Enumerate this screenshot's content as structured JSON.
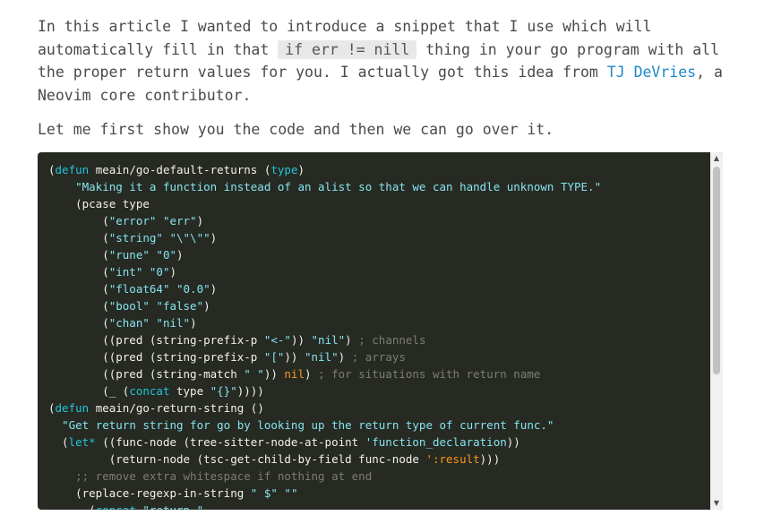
{
  "article": {
    "p1_before": "In this article I wanted to introduce a snippet that I use which will automatically fill in that ",
    "p1_code": "if err != nill",
    "p1_middle": " thing in your go program with all the proper return values for you. I actually got this idea from ",
    "p1_link": "TJ DeVries",
    "p1_after": ", a Neovim core contributor.",
    "p2": "Let me first show you the code and then we can go over it."
  },
  "code_block": {
    "lines": [
      [
        {
          "t": "("
        },
        {
          "t": "defun",
          "c": "kw"
        },
        {
          "t": " meain/go-default-returns ("
        },
        {
          "t": "type",
          "c": "kw"
        },
        {
          "t": ")"
        }
      ],
      [
        {
          "t": "    "
        },
        {
          "t": "\"Making it a function instead of an alist so that we can handle unknown TYPE.\"",
          "c": "str"
        }
      ],
      [
        {
          "t": "    (pcase type"
        }
      ],
      [
        {
          "t": "        ("
        },
        {
          "t": "\"error\"",
          "c": "str"
        },
        {
          "t": " "
        },
        {
          "t": "\"err\"",
          "c": "str"
        },
        {
          "t": ")"
        }
      ],
      [
        {
          "t": "        ("
        },
        {
          "t": "\"string\"",
          "c": "str"
        },
        {
          "t": " "
        },
        {
          "t": "\"\\\"\\\"\"",
          "c": "str"
        },
        {
          "t": ")"
        }
      ],
      [
        {
          "t": "        ("
        },
        {
          "t": "\"rune\"",
          "c": "str"
        },
        {
          "t": " "
        },
        {
          "t": "\"0\"",
          "c": "str"
        },
        {
          "t": ")"
        }
      ],
      [
        {
          "t": "        ("
        },
        {
          "t": "\"int\"",
          "c": "str"
        },
        {
          "t": " "
        },
        {
          "t": "\"0\"",
          "c": "str"
        },
        {
          "t": ")"
        }
      ],
      [
        {
          "t": "        ("
        },
        {
          "t": "\"float64\"",
          "c": "str"
        },
        {
          "t": " "
        },
        {
          "t": "\"0.0\"",
          "c": "str"
        },
        {
          "t": ")"
        }
      ],
      [
        {
          "t": "        ("
        },
        {
          "t": "\"bool\"",
          "c": "str"
        },
        {
          "t": " "
        },
        {
          "t": "\"false\"",
          "c": "str"
        },
        {
          "t": ")"
        }
      ],
      [
        {
          "t": "        ("
        },
        {
          "t": "\"chan\"",
          "c": "str"
        },
        {
          "t": " "
        },
        {
          "t": "\"nil\"",
          "c": "str"
        },
        {
          "t": ")"
        }
      ],
      [
        {
          "t": "        ((pred (string-prefix-p "
        },
        {
          "t": "\"<-\"",
          "c": "str"
        },
        {
          "t": ")) "
        },
        {
          "t": "\"nil\"",
          "c": "str"
        },
        {
          "t": ") "
        },
        {
          "t": "; channels",
          "c": "cm"
        }
      ],
      [
        {
          "t": "        ((pred (string-prefix-p "
        },
        {
          "t": "\"[\"",
          "c": "str"
        },
        {
          "t": ")) "
        },
        {
          "t": "\"nil\"",
          "c": "str"
        },
        {
          "t": ") "
        },
        {
          "t": "; arrays",
          "c": "cm"
        }
      ],
      [
        {
          "t": "        ((pred (string-match "
        },
        {
          "t": "\" \"",
          "c": "str"
        },
        {
          "t": ")) "
        },
        {
          "t": "nil",
          "c": "org"
        },
        {
          "t": ") "
        },
        {
          "t": "; for situations with return name",
          "c": "cm"
        }
      ],
      [
        {
          "t": "        (_ ("
        },
        {
          "t": "concat",
          "c": "kw"
        },
        {
          "t": " type "
        },
        {
          "t": "\"{}\"",
          "c": "str"
        },
        {
          "t": "))))"
        }
      ],
      [
        {
          "t": "("
        },
        {
          "t": "defun",
          "c": "kw"
        },
        {
          "t": " meain/go-return-string ()"
        }
      ],
      [
        {
          "t": "  "
        },
        {
          "t": "\"Get return string for go by looking up the return type of current func.\"",
          "c": "str"
        }
      ],
      [
        {
          "t": "  ("
        },
        {
          "t": "let*",
          "c": "kw"
        },
        {
          "t": " ((func-node (tree-sitter-node-at-point "
        },
        {
          "t": "'function_declaration",
          "c": "str"
        },
        {
          "t": "))"
        }
      ],
      [
        {
          "t": "         (return-node (tsc-get-child-by-field func-node "
        },
        {
          "t": "':result",
          "c": "org"
        },
        {
          "t": ")))"
        }
      ],
      [
        {
          "t": "    "
        },
        {
          "t": ";; remove extra whitespace if nothing at end",
          "c": "cm"
        }
      ],
      [
        {
          "t": "    (replace-regexp-in-string "
        },
        {
          "t": "\" $\"",
          "c": "str"
        },
        {
          "t": " "
        },
        {
          "t": "\"\"",
          "c": "str"
        }
      ],
      [
        {
          "t": "      ("
        },
        {
          "t": "concat",
          "c": "kw"
        },
        {
          "t": " "
        },
        {
          "t": "\"return \"",
          "c": "str"
        }
      ]
    ],
    "colors": {
      "background": "#262a22",
      "text": "#f2f2ec",
      "keyword": "#22c4dc",
      "string": "#86e3f0",
      "comment": "#7c7e74",
      "constant": "#fd971f"
    }
  },
  "scrollbar": {
    "up_icon": "▲",
    "down_icon": "▼"
  }
}
